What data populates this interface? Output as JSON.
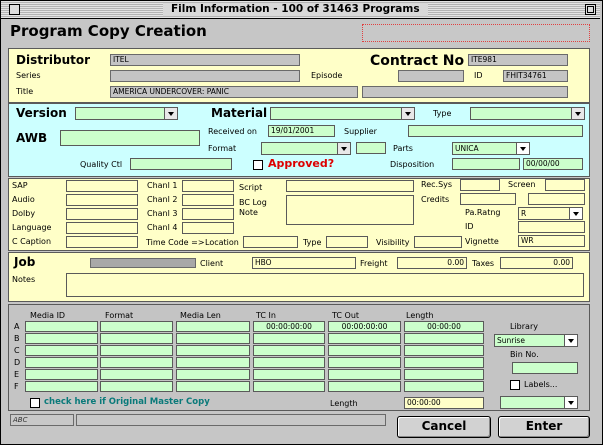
{
  "window": {
    "title": "Film Information - 100 of 31463 Programs"
  },
  "header": {
    "title": "Program Copy Creation",
    "status_value": ""
  },
  "distributor": {
    "label": "Distributor",
    "value": "ITEL",
    "contract_label": "Contract No",
    "contract_value": "ITE981",
    "series_label": "Series",
    "series_value": "",
    "episode_label": "Episode",
    "episode_value": "",
    "id_label": "ID",
    "id_value": "FHIT34761",
    "title_label": "Title",
    "title_value": "AMERICA UNDERCOVER: PANIC",
    "title_extra": ""
  },
  "version": {
    "label": "Version",
    "value": "",
    "material_label": "Material",
    "material_value": "",
    "type_label": "Type",
    "type_value": "",
    "awb_label": "AWB",
    "awb_value": "",
    "received_label": "Received on",
    "received_value": "19/01/2001",
    "supplier_label": "Supplier",
    "supplier_value": "",
    "format_label": "Format",
    "format_value": "",
    "format_extra": "",
    "parts_label": "Parts",
    "parts_value": "UNICA",
    "quality_label": "Quality Ctl",
    "quality_value": "",
    "approved_label": "Approved?",
    "disposition_label": "Disposition",
    "disposition_value": "",
    "disposition_date": "00/00/00"
  },
  "tech": {
    "sap_label": "SAP",
    "audio_label": "Audio",
    "dolby_label": "Dolby",
    "language_label": "Language",
    "ccaption_label": "C Caption",
    "chanl1_label": "Chanl 1",
    "chanl2_label": "Chanl 2",
    "chanl3_label": "Chanl 3",
    "chanl4_label": "Chanl 4",
    "script_label": "Script",
    "bclog_label": "BC Log",
    "note_label": "Note",
    "recsys_label": "Rec.Sys",
    "screen_label": "Screen",
    "credits_label": "Credits",
    "parating_label": "Pa.Ratng",
    "parating_value": "R",
    "id_label": "ID",
    "id_value": "",
    "vignette_label": "Vignette",
    "vignette_value": "WR",
    "timecode_label": "Time Code =>",
    "location_label": "Location",
    "type_label": "Type",
    "visibility_label": "Visibility"
  },
  "job": {
    "label": "Job",
    "client_label": "Client",
    "client_value": "HBO",
    "freight_label": "Freight",
    "freight_value": "0.00",
    "taxes_label": "Taxes",
    "taxes_value": "0.00",
    "notes_label": "Notes",
    "notes_value": ""
  },
  "media": {
    "headers": [
      "Media ID",
      "Format",
      "Media Len",
      "TC In",
      "TC Out",
      "Length"
    ],
    "rows": [
      {
        "letter": "A",
        "tc_in": "00:00:00:00",
        "tc_out": "00:00:00:00",
        "length": "00:00:00"
      },
      {
        "letter": "B",
        "tc_in": "",
        "tc_out": "",
        "length": ""
      },
      {
        "letter": "C",
        "tc_in": "",
        "tc_out": "",
        "length": ""
      },
      {
        "letter": "D",
        "tc_in": "",
        "tc_out": "",
        "length": ""
      },
      {
        "letter": "E",
        "tc_in": "",
        "tc_out": "",
        "length": ""
      },
      {
        "letter": "F",
        "tc_in": "",
        "tc_out": "",
        "length": ""
      }
    ],
    "library_label": "Library",
    "library_value": "Sunrise",
    "binno_label": "Bin No.",
    "binno_value": "",
    "labels_label": "Labels...",
    "labels_value": "",
    "original_master_label": "check here if Original Master Copy",
    "length_label": "Length",
    "length_value": "00:00:00"
  },
  "buttons": {
    "cancel": "Cancel",
    "enter": "Enter"
  },
  "statusbar": {
    "text": "ABC"
  }
}
